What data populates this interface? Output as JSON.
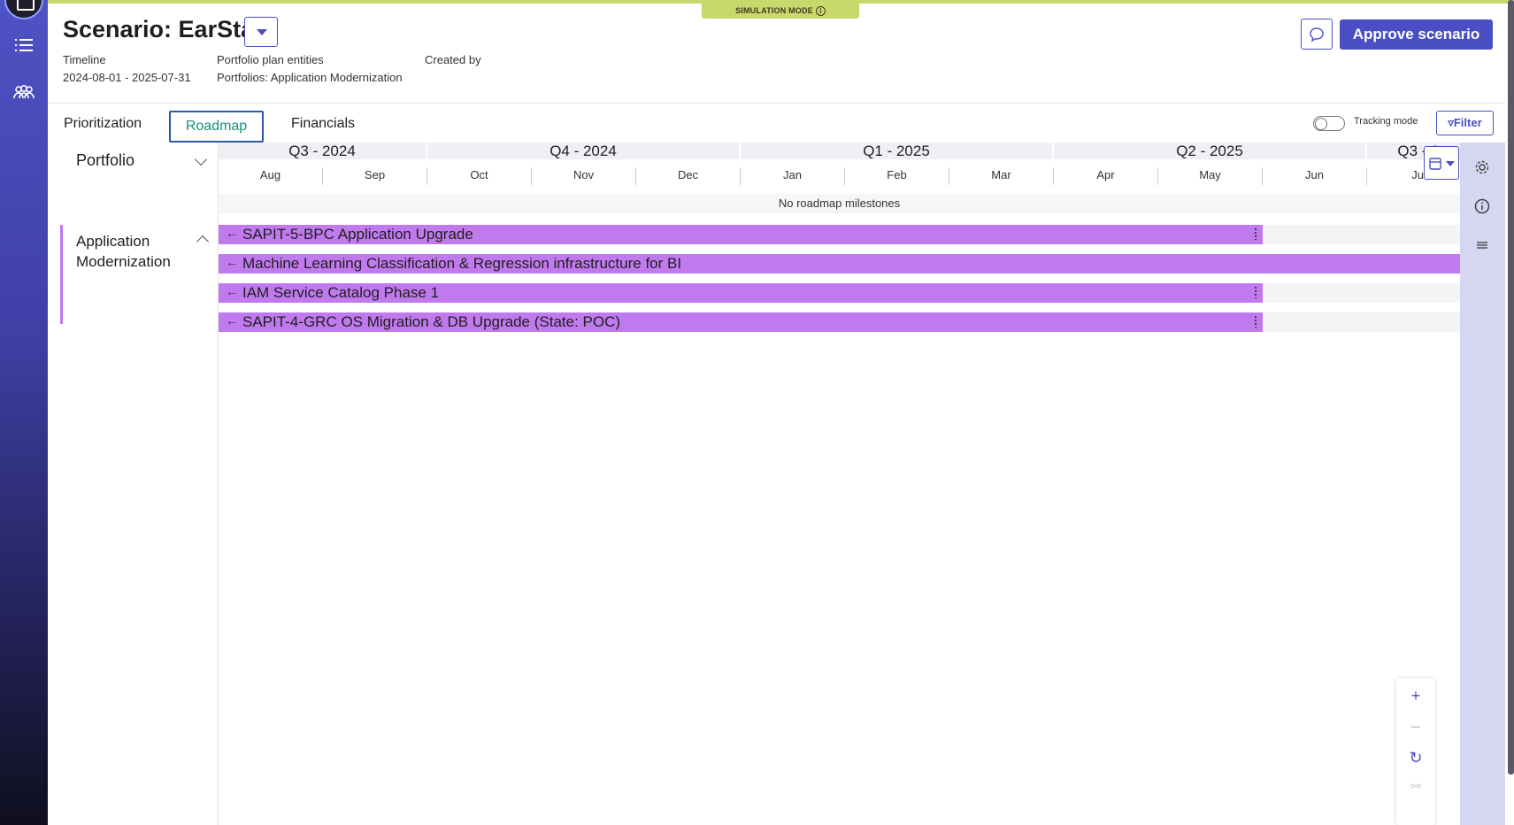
{
  "header": {
    "title": "Scenario: EarSta",
    "timeline_label": "Timeline",
    "timeline_value": "2024-08-01 - 2025-07-31",
    "entities_label": "Portfolio plan entities",
    "entities_value": "Portfolios: Application Modernization",
    "created_by_label": "Created by",
    "simulation_badge": "SIMULATION MODE",
    "approve_label": "Approve scenario"
  },
  "tabs": [
    "Prioritization",
    "Roadmap",
    "Financials"
  ],
  "active_tab": "Roadmap",
  "toolbar": {
    "tracking_mode_label": "Tracking mode",
    "tracking_mode_on": false,
    "filter_label": "Filter"
  },
  "left_panel": {
    "portfolio_header": "Portfolio",
    "group_label": "Application Modernization"
  },
  "timeline": {
    "quarters": [
      "Q3 - 2024",
      "Q4 - 2024",
      "Q1 - 2025",
      "Q2 - 2025",
      "Q3 - 2"
    ],
    "months": [
      "Aug",
      "Sep",
      "Oct",
      "Nov",
      "Dec",
      "Jan",
      "Feb",
      "Mar",
      "Apr",
      "May",
      "Jun",
      "Jul"
    ],
    "milestones_text": "No roadmap milestones"
  },
  "roadmap_items": [
    {
      "label": "SAPIT-5-BPC Application Upgrade",
      "start": "2024-08-01",
      "end": "2025-05-31"
    },
    {
      "label": "Machine Learning Classification & Regression infrastructure for BI",
      "start": "2024-08-01",
      "end": "2025-07-31"
    },
    {
      "label": "IAM Service Catalog Phase 1",
      "start": "2024-08-01",
      "end": "2025-05-31"
    },
    {
      "label": "SAPIT-4-GRC OS Migration & DB Upgrade (State: POC)",
      "start": "2024-08-01",
      "end": "2025-05-31"
    }
  ],
  "colors": {
    "accent": "#4a4fc4",
    "bar": "#c17aee",
    "simulation_badge": "#c9d86a",
    "active_tab_text": "#16907c"
  },
  "zoom": {
    "in_icon": "plus-icon",
    "out_icon": "minus-icon",
    "reset_icon": "refresh-icon",
    "link_icon": "link-icon"
  }
}
